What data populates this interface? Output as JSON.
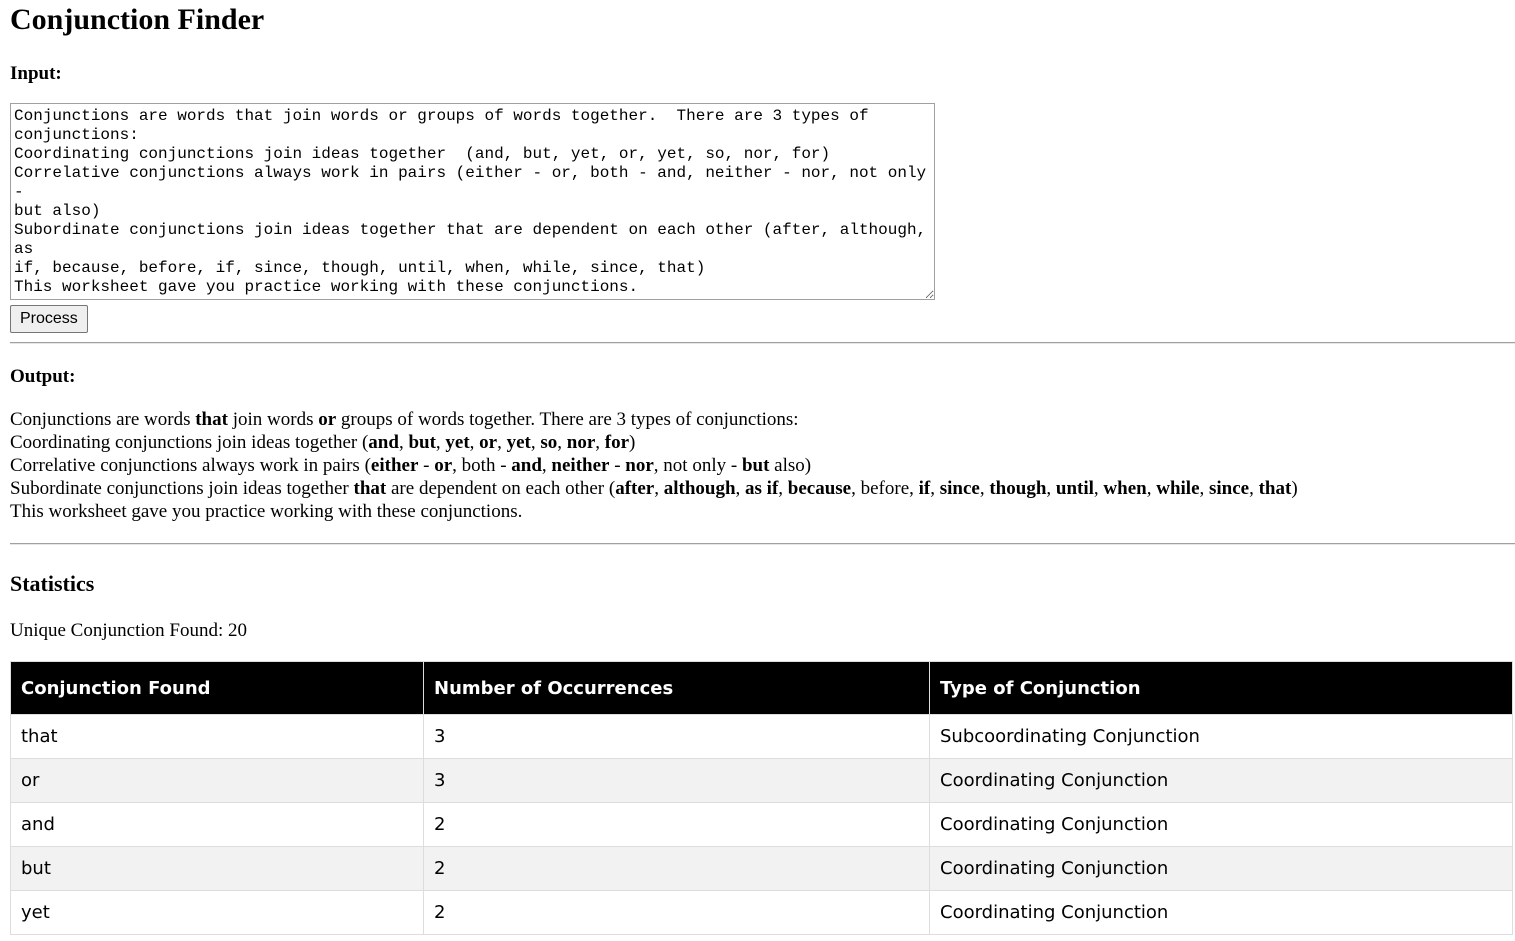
{
  "page_title": "Conjunction Finder",
  "input": {
    "heading": "Input:",
    "text": "Conjunctions are words that join words or groups of words together.  There are 3 types of\nconjunctions:\nCoordinating conjunctions join ideas together  (and, but, yet, or, yet, so, nor, for)\nCorrelative conjunctions always work in pairs (either - or, both - and, neither - nor, not only -\nbut also)\nSubordinate conjunctions join ideas together that are dependent on each other (after, although, as\nif, because, before, if, since, though, until, when, while, since, that)\nThis worksheet gave you practice working with these conjunctions.",
    "button_label": "Process"
  },
  "output": {
    "heading": "Output:",
    "lines": [
      [
        {
          "t": "Conjunctions are words ",
          "b": false
        },
        {
          "t": "that",
          "b": true
        },
        {
          "t": " join words ",
          "b": false
        },
        {
          "t": "or",
          "b": true
        },
        {
          "t": " groups of words together. There are 3 types of conjunctions:",
          "b": false
        }
      ],
      [
        {
          "t": "Coordinating conjunctions join ideas together (",
          "b": false
        },
        {
          "t": "and",
          "b": true
        },
        {
          "t": ", ",
          "b": false
        },
        {
          "t": "but",
          "b": true
        },
        {
          "t": ", ",
          "b": false
        },
        {
          "t": "yet",
          "b": true
        },
        {
          "t": ", ",
          "b": false
        },
        {
          "t": "or",
          "b": true
        },
        {
          "t": ", ",
          "b": false
        },
        {
          "t": "yet",
          "b": true
        },
        {
          "t": ", ",
          "b": false
        },
        {
          "t": "so",
          "b": true
        },
        {
          "t": ", ",
          "b": false
        },
        {
          "t": "nor",
          "b": true
        },
        {
          "t": ", ",
          "b": false
        },
        {
          "t": "for",
          "b": true
        },
        {
          "t": ")",
          "b": false
        }
      ],
      [
        {
          "t": "Correlative conjunctions always work in pairs (",
          "b": false
        },
        {
          "t": "either",
          "b": true
        },
        {
          "t": " - ",
          "b": false
        },
        {
          "t": "or",
          "b": true
        },
        {
          "t": ", both - ",
          "b": false
        },
        {
          "t": "and",
          "b": true
        },
        {
          "t": ", ",
          "b": false
        },
        {
          "t": "neither",
          "b": true
        },
        {
          "t": " - ",
          "b": false
        },
        {
          "t": "nor",
          "b": true
        },
        {
          "t": ", not only - ",
          "b": false
        },
        {
          "t": "but",
          "b": true
        },
        {
          "t": " also)",
          "b": false
        }
      ],
      [
        {
          "t": "Subordinate conjunctions join ideas together ",
          "b": false
        },
        {
          "t": "that",
          "b": true
        },
        {
          "t": " are dependent on each other (",
          "b": false
        },
        {
          "t": "after",
          "b": true
        },
        {
          "t": ", ",
          "b": false
        },
        {
          "t": "although",
          "b": true
        },
        {
          "t": ", ",
          "b": false
        },
        {
          "t": "as if",
          "b": true
        },
        {
          "t": ", ",
          "b": false
        },
        {
          "t": "because",
          "b": true
        },
        {
          "t": ", before, ",
          "b": false
        },
        {
          "t": "if",
          "b": true
        },
        {
          "t": ", ",
          "b": false
        },
        {
          "t": "since",
          "b": true
        },
        {
          "t": ", ",
          "b": false
        },
        {
          "t": "though",
          "b": true
        },
        {
          "t": ", ",
          "b": false
        },
        {
          "t": "until",
          "b": true
        },
        {
          "t": ", ",
          "b": false
        },
        {
          "t": "when",
          "b": true
        },
        {
          "t": ", ",
          "b": false
        },
        {
          "t": "while",
          "b": true
        },
        {
          "t": ", ",
          "b": false
        },
        {
          "t": "since",
          "b": true
        },
        {
          "t": ", ",
          "b": false
        },
        {
          "t": "that",
          "b": true
        },
        {
          "t": ")",
          "b": false
        }
      ],
      [
        {
          "t": "This worksheet gave you practice working with these conjunctions.",
          "b": false
        }
      ]
    ]
  },
  "statistics": {
    "heading": "Statistics",
    "unique_label": "Unique Conjunction Found: ",
    "unique_count": "20",
    "table": {
      "headers": [
        "Conjunction Found",
        "Number of Occurrences",
        "Type of Conjunction"
      ],
      "rows": [
        [
          "that",
          "3",
          "Subcoordinating Conjunction"
        ],
        [
          "or",
          "3",
          "Coordinating Conjunction"
        ],
        [
          "and",
          "2",
          "Coordinating Conjunction"
        ],
        [
          "but",
          "2",
          "Coordinating Conjunction"
        ],
        [
          "yet",
          "2",
          "Coordinating Conjunction"
        ]
      ]
    }
  }
}
